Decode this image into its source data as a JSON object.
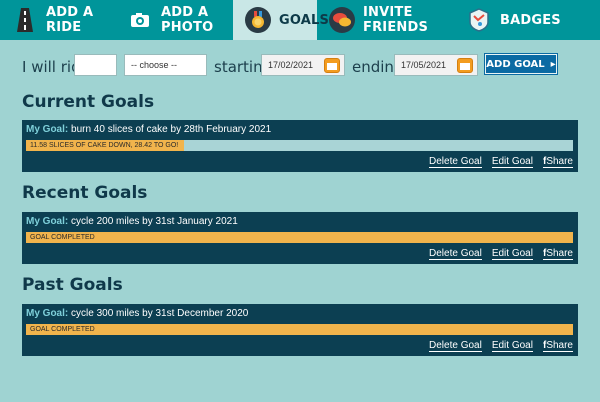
{
  "nav": {
    "tabs": [
      {
        "label": "ADD A RIDE",
        "icon": "road-icon"
      },
      {
        "label": "ADD A PHOTO",
        "icon": "camera-icon"
      },
      {
        "label": "GOALS",
        "icon": "medal-icon"
      },
      {
        "label": "INVITE FRIENDS",
        "icon": "speech-bubbles-icon"
      },
      {
        "label": "BADGES",
        "icon": "map-badge-icon"
      }
    ],
    "active_tab": "GOALS"
  },
  "form": {
    "i_will_ride": "I will ride",
    "amount_value": "",
    "unit_select": "-- choose --",
    "starting_label": "starting",
    "start_date": "17/02/2021",
    "ending_label": "ending",
    "end_date": "17/05/2021",
    "add_goal_label": "ADD GOAL",
    "add_goal_arrow": "▸"
  },
  "sections": [
    {
      "title": "Current Goals",
      "goal_prefix": "My Goal:",
      "goal_text": "burn 40 slices of cake by 28th February 2021",
      "progress_text": "11.58 SLICES OF CAKE DOWN, 28.42 TO GO!",
      "progress_fraction": 0.2895
    },
    {
      "title": "Recent Goals",
      "goal_prefix": "My Goal:",
      "goal_text": "cycle 200 miles by 31st January 2021",
      "progress_text": "GOAL COMPLETED",
      "progress_fraction": 1.0
    },
    {
      "title": "Past Goals",
      "goal_prefix": "My Goal:",
      "goal_text": "cycle 300 miles by 31st December 2020",
      "progress_text": "GOAL COMPLETED",
      "progress_fraction": 1.0
    }
  ],
  "actions": {
    "delete": "Delete Goal",
    "edit": "Edit Goal",
    "share_icon": "f",
    "share": "Share"
  },
  "colors": {
    "nav_bg": "#00959a",
    "active_tab_bg": "#c9e7e6",
    "page_bg": "#9fd3d2",
    "goal_box_bg": "#0c3f52",
    "progress_fill": "#f1b44c",
    "button_blue": "#0b6aa3"
  }
}
